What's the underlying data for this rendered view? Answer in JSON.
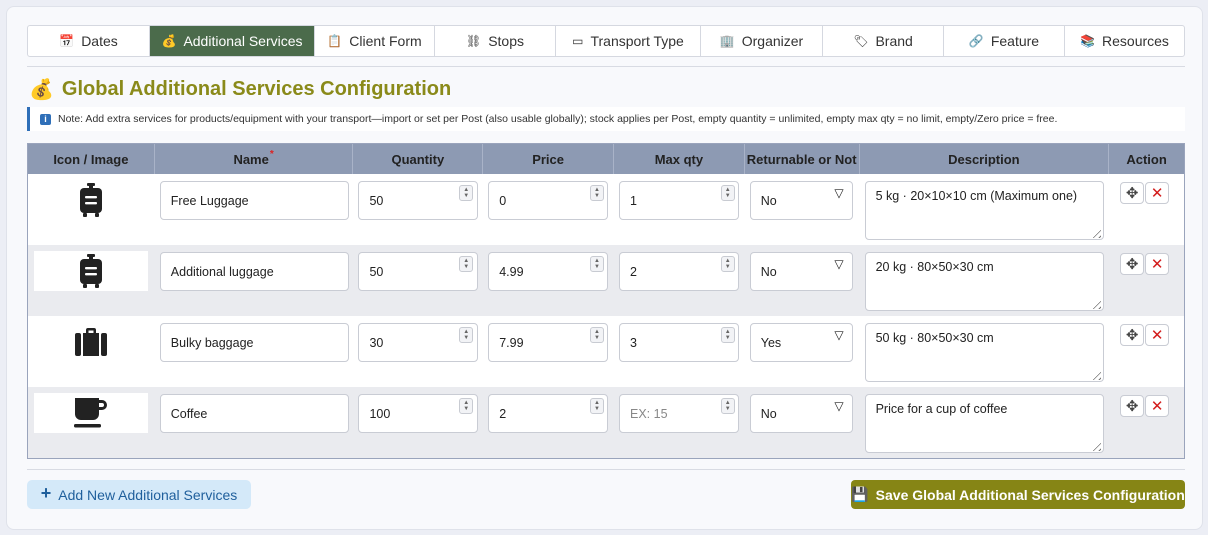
{
  "tabs": [
    {
      "icon": "📅",
      "icon_name": "calendar-icon",
      "label": "Dates"
    },
    {
      "icon": "💰",
      "icon_name": "money-bag-icon",
      "label": "Additional Services"
    },
    {
      "icon": "📋",
      "icon_name": "clipboard-icon",
      "label": "Client Form"
    },
    {
      "icon": "⛓",
      "icon_name": "route-icon",
      "label": "Stops"
    },
    {
      "icon": "▭",
      "icon_name": "card-icon",
      "label": "Transport Type"
    },
    {
      "icon": "🏢",
      "icon_name": "office-icon",
      "label": "Organizer"
    },
    {
      "icon": "🏷",
      "icon_name": "tag-icon",
      "label": "Brand"
    },
    {
      "icon": "🔗",
      "icon_name": "link-icon",
      "label": "Feature"
    },
    {
      "icon": "📚",
      "icon_name": "books-icon",
      "label": "Resources"
    }
  ],
  "active_tab": "Additional Services",
  "title": {
    "icon": "💰",
    "text": "Global Additional Services Configuration"
  },
  "note": "Note: Add extra services for products/equipment with your transport—import or set per Post (also usable globally); stock applies per Post, empty quantity = unlimited, empty max qty = no limit, empty/Zero price = free.",
  "table": {
    "headers": {
      "icon": "Icon / Image",
      "name": "Name",
      "name_required": "*",
      "quantity": "Quantity",
      "price": "Price",
      "max_qty": "Max qty",
      "returnable": "Returnable or Not",
      "description": "Description",
      "action": "Action"
    },
    "rows": [
      {
        "icon": "luggage-icon",
        "name": "Free Luggage",
        "quantity": "50",
        "price": "0",
        "max_qty": "1",
        "max_qty_placeholder": "",
        "returnable": "No",
        "description": "5 kg · 20×10×10 cm (Maximum one)"
      },
      {
        "icon": "luggage-icon",
        "name": "Additional luggage",
        "quantity": "50",
        "price": "4.99",
        "max_qty": "2",
        "max_qty_placeholder": "",
        "returnable": "No",
        "description": "20 kg · 80×50×30 cm"
      },
      {
        "icon": "suitcase-icon",
        "name": "Bulky baggage",
        "quantity": "30",
        "price": "7.99",
        "max_qty": "3",
        "max_qty_placeholder": "",
        "returnable": "Yes",
        "description": "50 kg · 80×50×30 cm"
      },
      {
        "icon": "coffee-icon",
        "name": "Coffee",
        "quantity": "100",
        "price": "2",
        "max_qty": "",
        "max_qty_placeholder": "EX: 15",
        "returnable": "No",
        "description": "Price for a cup of coffee"
      }
    ]
  },
  "buttons": {
    "add": "Add New Additional Services",
    "save": "Save Global Additional Services Configuration"
  },
  "colors": {
    "active_tab": "#4b6b4b",
    "title": "#8a8a1a",
    "table_header": "#8d9ab3",
    "save_button": "#868515",
    "add_button": "#d4e9f9",
    "delete": "#d31c1c"
  }
}
